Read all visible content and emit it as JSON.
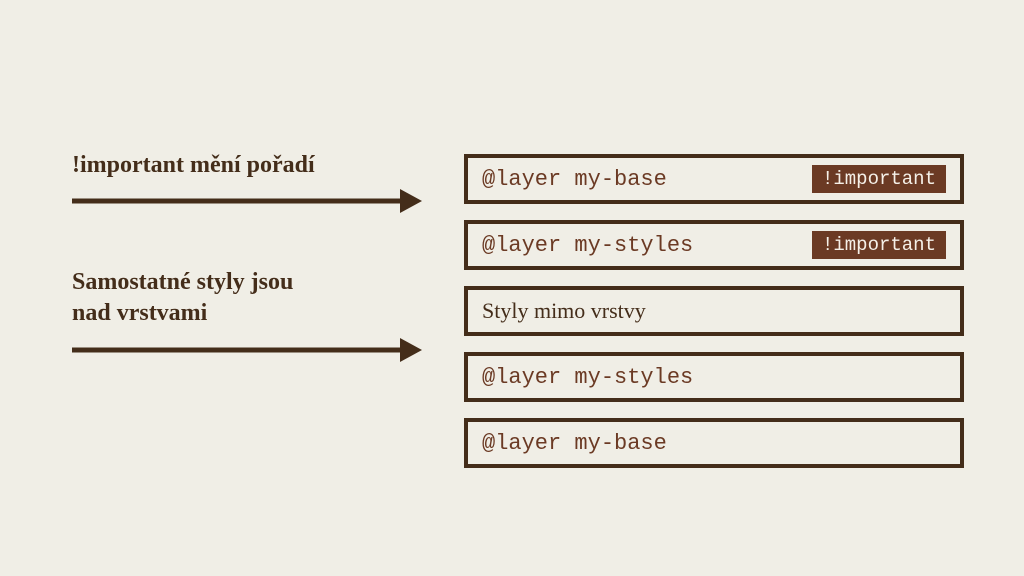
{
  "left": {
    "annotation1": "!important mění pořadí",
    "annotation2_line1": "Samostatné styly jsou",
    "annotation2_line2": "nad vrstvami"
  },
  "boxes": [
    {
      "label": "@layer my-base",
      "code": true,
      "badge": "!important"
    },
    {
      "label": "@layer my-styles",
      "code": true,
      "badge": "!important"
    },
    {
      "label": "Styly mimo vrstvy",
      "code": false,
      "badge": null
    },
    {
      "label": "@layer my-styles",
      "code": true,
      "badge": null
    },
    {
      "label": "@layer my-base",
      "code": true,
      "badge": null
    }
  ]
}
